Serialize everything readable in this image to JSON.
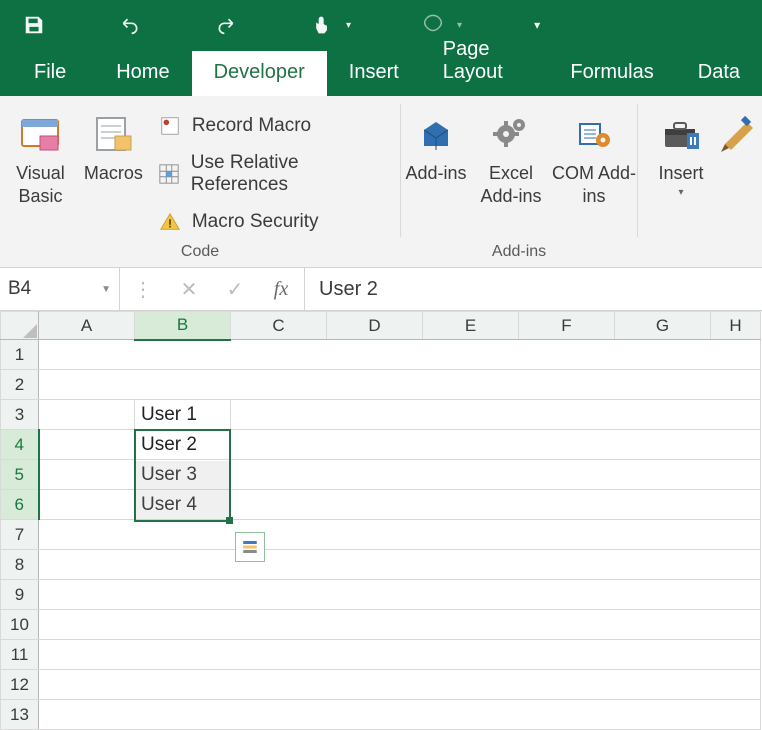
{
  "qat": {
    "menu_dropdown": "▾"
  },
  "tabs": {
    "file": "File",
    "home": "Home",
    "developer": "Developer",
    "insert": "Insert",
    "page_layout": "Page Layout",
    "formulas": "Formulas",
    "data": "Data",
    "active": "developer"
  },
  "ribbon": {
    "code": {
      "visual_basic": "Visual Basic",
      "macros": "Macros",
      "record_macro": "Record Macro",
      "use_relative": "Use Relative References",
      "macro_security": "Macro Security",
      "group_label": "Code"
    },
    "addins": {
      "addins": "Add-ins",
      "excel_addins": "Excel Add-ins",
      "com_addins": "COM Add-ins",
      "group_label": "Add-ins"
    },
    "controls": {
      "insert": "Insert",
      "design_mode": "Design Mode"
    }
  },
  "formula_bar": {
    "name_box": "B4",
    "fx_label": "fx",
    "value": "User 2"
  },
  "columns": [
    "A",
    "B",
    "C",
    "D",
    "E",
    "F",
    "G",
    "H"
  ],
  "rows": [
    "1",
    "2",
    "3",
    "4",
    "5",
    "6",
    "7",
    "8",
    "9",
    "10",
    "11",
    "12",
    "13"
  ],
  "cells": {
    "B3": "User 1",
    "B4": "User 2",
    "B5": "User 3",
    "B6": "User 4"
  },
  "selection": {
    "active_cell": "B4",
    "range": "B4:B6",
    "selected_row_headers": [
      "4",
      "5",
      "6"
    ],
    "selected_col_headers": [
      "B"
    ]
  }
}
